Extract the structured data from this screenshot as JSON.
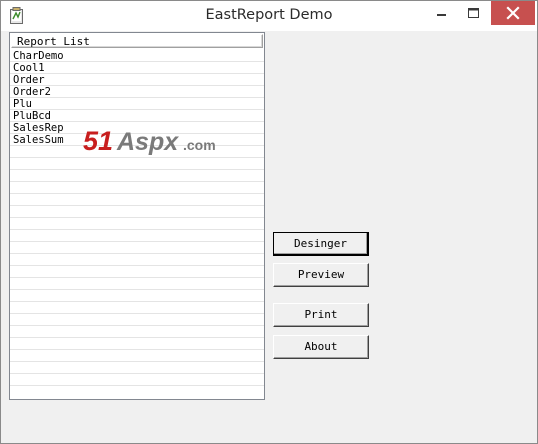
{
  "window": {
    "title": "EastReport Demo"
  },
  "report_list": {
    "header": "Report List",
    "items": [
      "CharDemo",
      "Cool1",
      "Order",
      "Order2",
      "Plu",
      "PluBcd",
      "SalesRep",
      "SalesSum",
      "",
      "",
      "",
      "",
      "",
      "",
      "",
      "",
      "",
      "",
      "",
      "",
      "",
      "",
      "",
      "",
      "",
      "",
      "",
      "",
      ""
    ]
  },
  "watermark": {
    "text_51": "51",
    "text_aspx": "Aspx",
    "text_com": ".com",
    "color_51": "#c81e1e",
    "color_aspx": "#7a7a7a"
  },
  "buttons": {
    "designer": "Desinger",
    "preview": "Preview",
    "print": "Print",
    "about": "About"
  },
  "colors": {
    "close_button": "#c7504f",
    "titlebar": "#ffffff",
    "background": "#f0f0f0"
  }
}
